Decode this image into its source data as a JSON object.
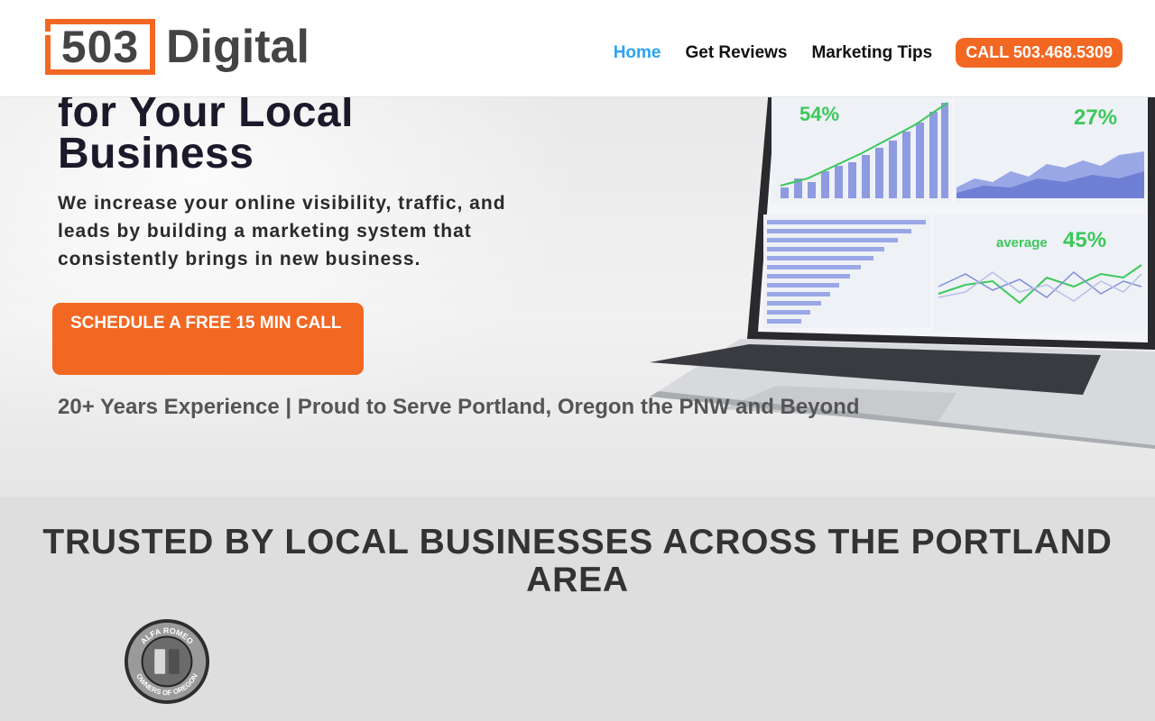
{
  "brand": {
    "logo_number": "503",
    "logo_word": "Digital"
  },
  "nav": {
    "items": [
      {
        "label": "Home",
        "active": true
      },
      {
        "label": "Get Reviews",
        "active": false
      },
      {
        "label": "Marketing Tips",
        "active": false
      }
    ],
    "call_label": "CALL 503.468.5309"
  },
  "hero": {
    "title_line1": "for Your Local",
    "title_line2": "Business",
    "subtitle": "We increase your online visibility, traffic, and leads by building a marketing system that consistently brings in new business.",
    "cta_label": "SCHEDULE A FREE 15 MIN CALL",
    "experience": "20+ Years Experience | Proud to Serve Portland, Oregon the PNW and Beyond",
    "screen_stats": {
      "stat1": "54%",
      "stat2": "27%",
      "stat3_label": "average",
      "stat3": "45%"
    }
  },
  "trusted": {
    "title": "TRUSTED BY LOCAL BUSINESSES ACROSS THE PORTLAND AREA",
    "client_logo_text_top": "ALFA ROMEO",
    "client_logo_text_bottom": "OWNERS OF OREGON"
  },
  "colors": {
    "accent": "#f26722",
    "link_active": "#2ea3f2",
    "chart_green": "#3cc85a",
    "chart_blue": "#7f8fd9"
  }
}
